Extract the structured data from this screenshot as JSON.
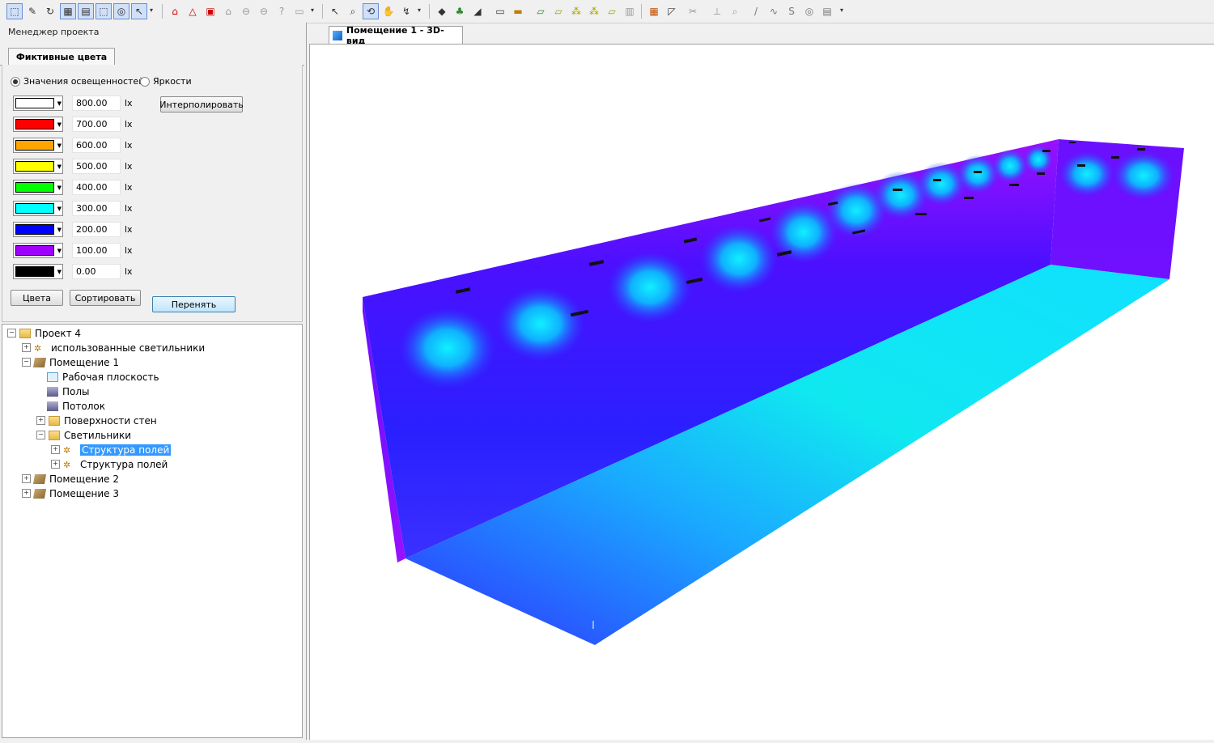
{
  "project_manager": {
    "title": "Менеджер проекта"
  },
  "tabs": {
    "false_colors": "Фиктивные цвета"
  },
  "radio": {
    "illuminance": "Значения освещенностей",
    "luminance": "Яркости"
  },
  "colors": [
    {
      "color": "#ffffff",
      "value": "800.00",
      "unit": "lx"
    },
    {
      "color": "#ff0000",
      "value": "700.00",
      "unit": "lx"
    },
    {
      "color": "#ffa500",
      "value": "600.00",
      "unit": "lx"
    },
    {
      "color": "#ffff00",
      "value": "500.00",
      "unit": "lx"
    },
    {
      "color": "#00ff00",
      "value": "400.00",
      "unit": "lx"
    },
    {
      "color": "#00ffff",
      "value": "300.00",
      "unit": "lx"
    },
    {
      "color": "#0000ff",
      "value": "200.00",
      "unit": "lx"
    },
    {
      "color": "#a000ff",
      "value": "100.00",
      "unit": "lx"
    },
    {
      "color": "#000000",
      "value": "0.00",
      "unit": "lx"
    }
  ],
  "buttons": {
    "interpolate": "Интерполировать",
    "colors": "Цвета",
    "sort": "Сортировать",
    "adopt": "Перенять"
  },
  "tree": [
    {
      "label": "Проект 4",
      "expander": "−",
      "icon": "folder"
    },
    {
      "label": "использованные светильники",
      "expander": "+",
      "icon": "luminaire"
    },
    {
      "label": "Помещение 1",
      "expander": "−",
      "icon": "room"
    },
    {
      "label": "Рабочая плоскость",
      "expander": "",
      "icon": "plane"
    },
    {
      "label": "Полы",
      "expander": "",
      "icon": "floor"
    },
    {
      "label": "Потолок",
      "expander": "",
      "icon": "floor"
    },
    {
      "label": "Поверхности стен",
      "expander": "+",
      "icon": "folder"
    },
    {
      "label": "Светильники",
      "expander": "−",
      "icon": "folder"
    },
    {
      "label": "Структура полей",
      "expander": "+",
      "icon": "luminaire"
    },
    {
      "label": "Структура полей",
      "expander": "+",
      "icon": "luminaire"
    },
    {
      "label": "Помещение 2",
      "expander": "+",
      "icon": "room"
    },
    {
      "label": "Помещение 3",
      "expander": "+",
      "icon": "room"
    }
  ],
  "view": {
    "tab_label": "Помещение 1 - 3D-вид"
  }
}
